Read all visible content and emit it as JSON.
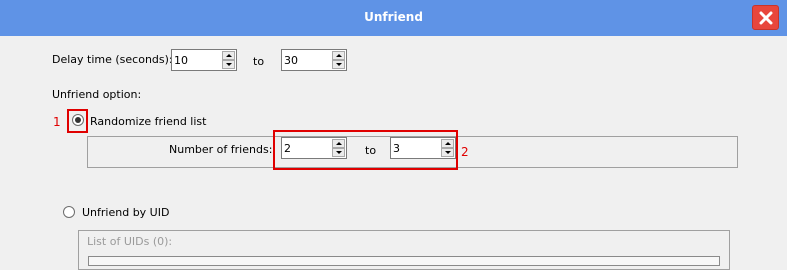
{
  "window": {
    "title": "Unfriend",
    "close_icon": "close-icon"
  },
  "delay": {
    "label": "Delay time (seconds):",
    "from_value": "10",
    "to_label": "to",
    "to_value": "30"
  },
  "unfriend_option": {
    "label": "Unfriend option:"
  },
  "randomize": {
    "label": "Randomize friend list",
    "selected": true,
    "number_label": "Number of friends:",
    "from_value": "2",
    "to_label": "to",
    "to_value": "3"
  },
  "by_uid": {
    "label": "Unfriend by UID",
    "selected": false,
    "list_label": "List of UIDs  (0):"
  },
  "annotations": {
    "one": "1",
    "two": "2",
    "color": "#e00000"
  },
  "colors": {
    "titlebar": "#5f93e6",
    "close": "#e8463c"
  }
}
